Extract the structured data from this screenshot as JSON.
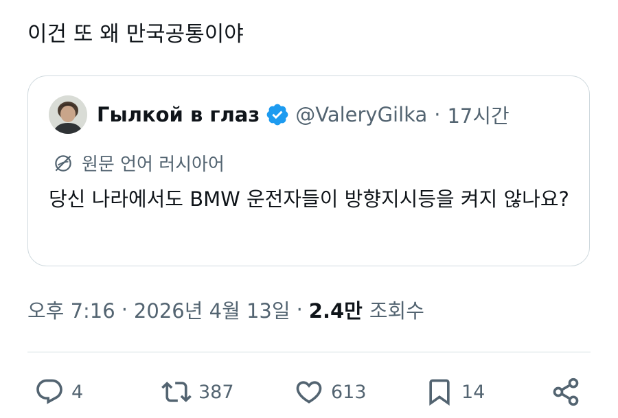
{
  "post": {
    "text": "이건 또 왜 만국공통이야"
  },
  "quote": {
    "author_name": "Гылкой в глаз",
    "handle": "@ValeryGilka",
    "separator": "·",
    "time": "17시간",
    "translate_label": "원문 언어 러시아어",
    "text": "당신 나라에서도 BMW 운전자들이 방향지시등을 켜지 않나요?"
  },
  "meta": {
    "time": "오후 7:16",
    "separator": "·",
    "date": "2026년 4월 13일",
    "separator2": "·",
    "views_count": "2.4만",
    "views_label": "조회수"
  },
  "actions": {
    "reply_count": "4",
    "repost_count": "387",
    "like_count": "613",
    "bookmark_count": "14"
  },
  "icons": {
    "verified": "verified-badge-icon",
    "translate": "globe-icon",
    "reply": "reply-icon",
    "repost": "repost-icon",
    "like": "heart-icon",
    "bookmark": "bookmark-icon",
    "share": "share-icon"
  },
  "colors": {
    "text": "#0f1419",
    "secondary": "#536471",
    "border": "#cfd9de",
    "verified": "#1d9bf0"
  }
}
